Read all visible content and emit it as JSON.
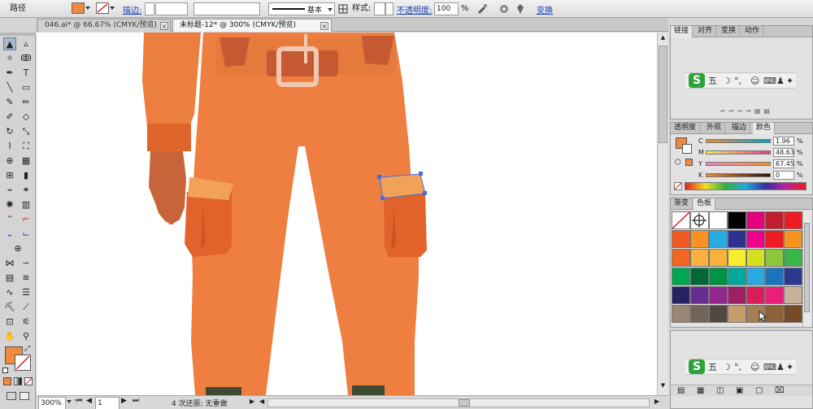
{
  "control_bar": {
    "object_type": "路径",
    "stroke_label": "描边:",
    "stroke_profile": "基本",
    "style_label": "样式:",
    "opacity_label": "不透明度:",
    "opacity_value": "100",
    "opacity_unit": "%",
    "transform_link": "变换",
    "fill_color": "#f08a3e"
  },
  "doc_tabs": [
    {
      "label": "046.ai* @ 66.67% (CMYK/预览)"
    },
    {
      "label": "未标题-12* @ 300% (CMYK/预览)"
    }
  ],
  "status_bar": {
    "zoom": "300%",
    "page": "1",
    "undo_text": "4 次还原; 无重做"
  },
  "panels": {
    "top_tabs": [
      "链接",
      "对齐",
      "变换",
      "动作"
    ],
    "color_tabs": [
      "透明度",
      "外观",
      "描边",
      "颜色"
    ],
    "color_sliders": [
      {
        "label": "C",
        "value": "1.96"
      },
      {
        "label": "M",
        "value": "48.63"
      },
      {
        "label": "Y",
        "value": "67.45"
      },
      {
        "label": "K",
        "value": "0"
      }
    ],
    "swatch_tabs": [
      "渐变",
      "色板"
    ],
    "swatch_colors": [
      "#e6007e",
      "#be1e2d",
      "#ed1c24",
      "#f15a24",
      "#f7931e",
      "#29abe2",
      "#2e3192",
      "#ec008c",
      "#ed1c24",
      "#f7941d",
      "#f26522",
      "#fbb040",
      "#fbb03b",
      "#f5ee30",
      "#d7df23",
      "#8dc63f",
      "#39b54a",
      "#00a651",
      "#006838",
      "#009245",
      "#00a99d",
      "#27aae1",
      "#1c75bc",
      "#2b388f",
      "#262262",
      "#662d91",
      "#92278f",
      "#9e1f63",
      "#d91c5c",
      "#ec1e79",
      "#c7b299",
      "#998675",
      "#736357",
      "#534741",
      "#c69c6d",
      "#a67c52",
      "#8c6239",
      "#754c24",
      "#603813",
      "#42210b"
    ]
  },
  "ime": {
    "logo": "S",
    "char": "五",
    "punct": "°,"
  }
}
